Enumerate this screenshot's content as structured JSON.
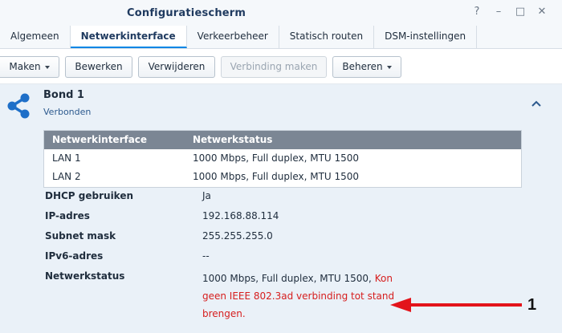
{
  "window": {
    "title": "Configuratiescherm",
    "controls": [
      "?",
      "–",
      "□",
      "✕"
    ]
  },
  "tabs": [
    {
      "label": "Algemeen",
      "active": false
    },
    {
      "label": "Netwerkinterface",
      "active": true
    },
    {
      "label": "Verkeerbeheer",
      "active": false
    },
    {
      "label": "Statisch routen",
      "active": false
    },
    {
      "label": "DSM-instellingen",
      "active": false
    }
  ],
  "toolbar": {
    "maken": "Maken",
    "bewerken": "Bewerken",
    "verwijderen": "Verwijderen",
    "verbinding_maken": "Verbinding maken",
    "beheren": "Beheren"
  },
  "bond": {
    "name": "Bond 1",
    "status": "Verbonden",
    "icon": "share-network-icon"
  },
  "interfaces_table": {
    "headers": [
      "Netwerkinterface",
      "Netwerkstatus"
    ],
    "rows": [
      [
        "LAN 1",
        "1000 Mbps, Full duplex, MTU 1500"
      ],
      [
        "LAN 2",
        "1000 Mbps, Full duplex, MTU 1500"
      ]
    ]
  },
  "properties": {
    "dhcp": {
      "label": "DHCP gebruiken",
      "value": "Ja"
    },
    "ip": {
      "label": "IP-adres",
      "value": "192.168.88.114"
    },
    "subnet": {
      "label": "Subnet mask",
      "value": "255.255.255.0"
    },
    "ipv6": {
      "label": "IPv6-adres",
      "value": "--"
    },
    "netstatus": {
      "label": "Netwerkstatus",
      "value": "1000 Mbps, Full duplex, MTU 1500,",
      "error_1": "Kon",
      "error_2": "geen IEEE 802.3ad verbinding tot stand",
      "error_3": "brengen."
    }
  },
  "annotation": {
    "number": "1"
  },
  "colors": {
    "accent": "#0086e5",
    "error": "#d61e1e",
    "table_header": "#7b8694",
    "panel": "#eaf1f8"
  }
}
